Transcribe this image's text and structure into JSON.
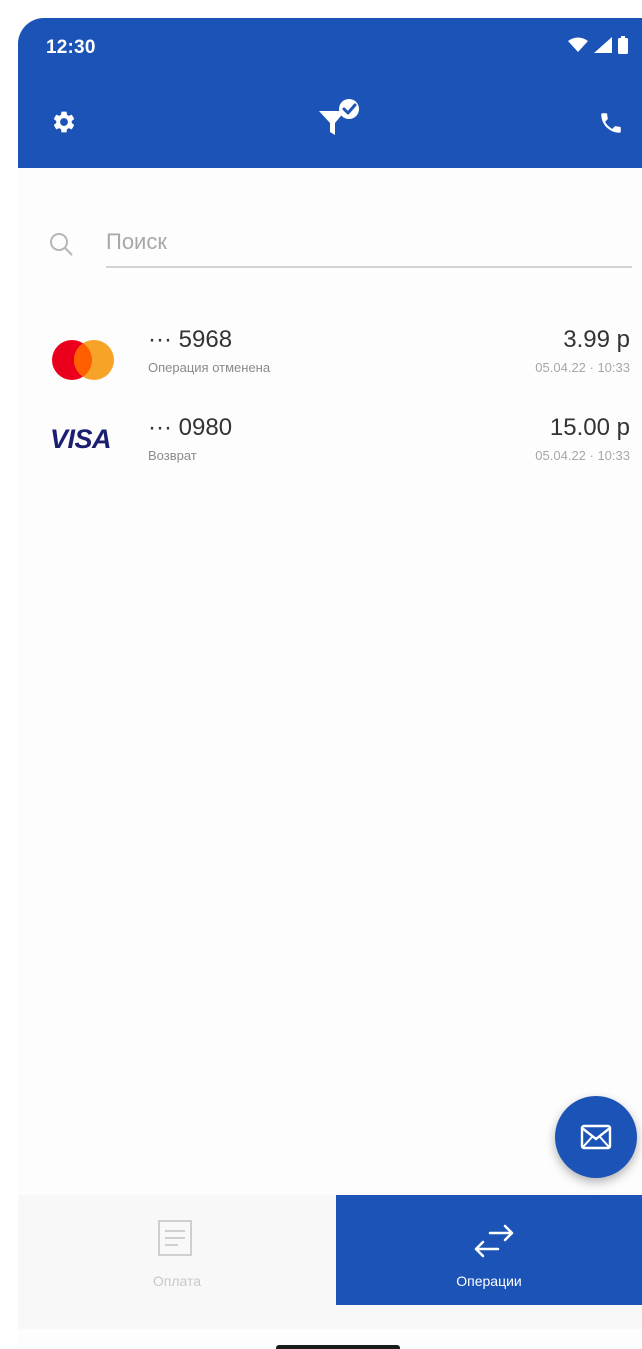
{
  "status_bar": {
    "time": "12:30"
  },
  "search": {
    "placeholder": "Поиск"
  },
  "transactions": [
    {
      "card_brand": "mastercard",
      "number": "··· 5968",
      "status": "Операция отменена",
      "amount": "3.99 р",
      "datetime": "05.04.22 · 10:33"
    },
    {
      "card_brand": "visa",
      "brand_label": "VISA",
      "number": "··· 0980",
      "status": "Возврат",
      "amount": "15.00 р",
      "datetime": "05.04.22 · 10:33"
    }
  ],
  "bottom_nav": {
    "items": [
      {
        "label": "Оплата",
        "icon": "receipt-icon",
        "active": false
      },
      {
        "label": "Операции",
        "icon": "swap-arrows-icon",
        "active": true
      }
    ]
  },
  "icons": {
    "settings": "gear-icon",
    "filter": "filter-check-icon",
    "call": "phone-icon",
    "search": "search-icon",
    "fab": "mail-icon"
  },
  "colors": {
    "primary": "#1c53b6",
    "background": "#fdfdfd",
    "mastercard_red": "#eb001b",
    "mastercard_orange": "#f79e1b",
    "visa_blue": "#1a1f71"
  }
}
